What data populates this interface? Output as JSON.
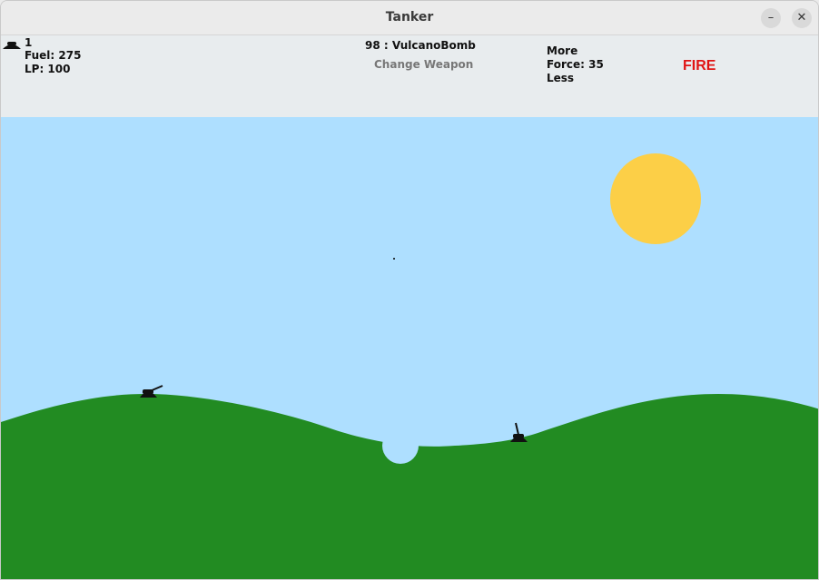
{
  "window": {
    "title": "Tanker"
  },
  "hud": {
    "player_number": "1",
    "fuel": "Fuel: 275",
    "lp": "LP: 100",
    "weapon": "98 : VulcanoBomb",
    "change_weapon": "Change Weapon",
    "more": "More",
    "force": "Force: 35",
    "less": "Less",
    "fire": "FIRE"
  },
  "colors": {
    "sky": "#aedfff",
    "ground": "#228b22",
    "sun": "#fccf47",
    "fire": "#e01414"
  }
}
